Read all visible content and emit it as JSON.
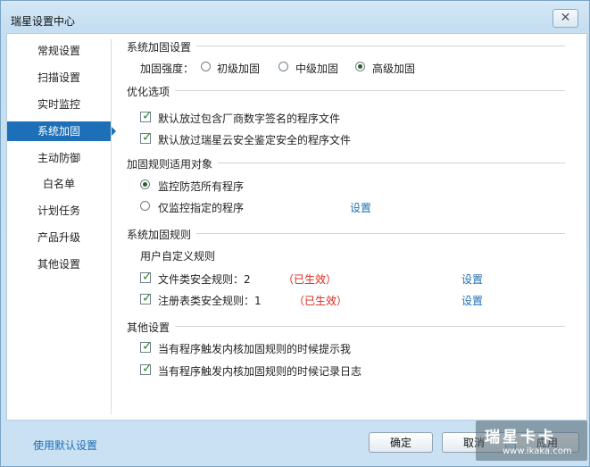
{
  "window": {
    "title": "瑞星设置中心",
    "close_label": "✕"
  },
  "sidebar": {
    "items": [
      {
        "label": "常规设置",
        "active": false
      },
      {
        "label": "扫描设置",
        "active": false
      },
      {
        "label": "实时监控",
        "active": false
      },
      {
        "label": "系统加固",
        "active": true
      },
      {
        "label": "主动防御",
        "active": false
      },
      {
        "label": "白名单",
        "active": false
      },
      {
        "label": "计划任务",
        "active": false
      },
      {
        "label": "产品升级",
        "active": false
      },
      {
        "label": "其他设置",
        "active": false
      }
    ]
  },
  "sections": {
    "hardening": {
      "title": "系统加固设置",
      "strength_label": "加固强度：",
      "options": [
        "初级加固",
        "中级加固",
        "高级加固"
      ],
      "selected": "高级加固"
    },
    "optimize": {
      "title": "优化选项",
      "items": [
        "默认放过包含厂商数字签名的程序文件",
        "默认放过瑞星云安全鉴定安全的程序文件"
      ]
    },
    "targets": {
      "title": "加固规则适用对象",
      "options": [
        "监控防范所有程序",
        "仅监控指定的程序"
      ],
      "selected": "监控防范所有程序",
      "settings_link": "设置"
    },
    "rules": {
      "title": "系统加固规则",
      "subtitle": "用户自定义规则",
      "items": [
        {
          "label": "文件类安全规则：2",
          "status": "（已生效）",
          "link": "设置"
        },
        {
          "label": "注册表类安全规则：1",
          "status": "（已生效）",
          "link": "设置"
        }
      ]
    },
    "other": {
      "title": "其他设置",
      "items": [
        "当有程序触发内核加固规则的时候提示我",
        "当有程序触发内核加固规则的时候记录日志"
      ]
    }
  },
  "footer": {
    "default_link": "使用默认设置",
    "ok_label": "确定",
    "cancel_label": "取消",
    "apply_label": "应用"
  },
  "watermark": {
    "logo": "瑞星卡卡",
    "url": "www.ikaka.com"
  },
  "colors": {
    "accent": "#1d6fb7",
    "status": "#d8261b"
  }
}
